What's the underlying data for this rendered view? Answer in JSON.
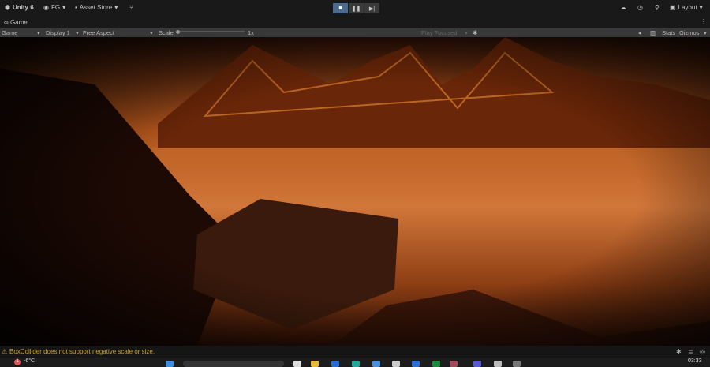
{
  "topbar": {
    "unity": "Unity 6",
    "account": "FG",
    "asset_store": "Asset Store",
    "layout": "Layout"
  },
  "tab": {
    "label": "Game"
  },
  "toolbar": {
    "view": "Game",
    "display": "Display 1",
    "aspect": "Free Aspect",
    "scale_label": "Scale",
    "scale_value": "1x",
    "play_mode": "Play Focused",
    "stats": "Stats",
    "gizmos": "Gizmos"
  },
  "console": {
    "message": "BoxCollider does not support negative scale or size."
  },
  "taskbar": {
    "weather": "-6°C",
    "weather_badge": "1",
    "clock": "03:33"
  },
  "colors": {
    "accent": "#4a6b8e",
    "warning": "#c9a227"
  }
}
